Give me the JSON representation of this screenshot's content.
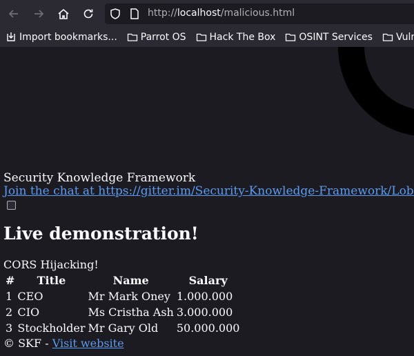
{
  "browser": {
    "url_prefix": "http://",
    "url_host": "localhost",
    "url_path": "/malicious.html"
  },
  "bookmarks": [
    {
      "label": "Import bookmarks...",
      "icon": "import-icon"
    },
    {
      "label": "Parrot OS",
      "icon": "folder-icon"
    },
    {
      "label": "Hack The Box",
      "icon": "folder-icon"
    },
    {
      "label": "OSINT Services",
      "icon": "folder-icon"
    },
    {
      "label": "Vuln DB",
      "icon": "folder-icon"
    }
  ],
  "page": {
    "site_title": "Security Knowledge Framework",
    "chat_link": "Join the chat at https://gitter.im/Security-Knowledge-Framework/Lobby",
    "heading": "Live demonstration!",
    "subtitle": "CORS Hijacking!",
    "table": {
      "headers": [
        "#",
        "Title",
        "Name",
        "Salary"
      ],
      "rows": [
        [
          "1",
          "CEO",
          "Mr Mark Oney",
          "1.000.000"
        ],
        [
          "2",
          "CIO",
          "Ms Cristha Ash",
          "3.000.000"
        ],
        [
          "3",
          "Stockholder",
          "Mr Gary Old",
          "50.000.000"
        ]
      ]
    },
    "footer_text": "© SKF - ",
    "footer_link": "Visit website"
  },
  "colors": {
    "background": "#1c1b22",
    "toolbar": "#2b2a33",
    "link": "#5b9bf0",
    "text": "#fbfbfe"
  }
}
